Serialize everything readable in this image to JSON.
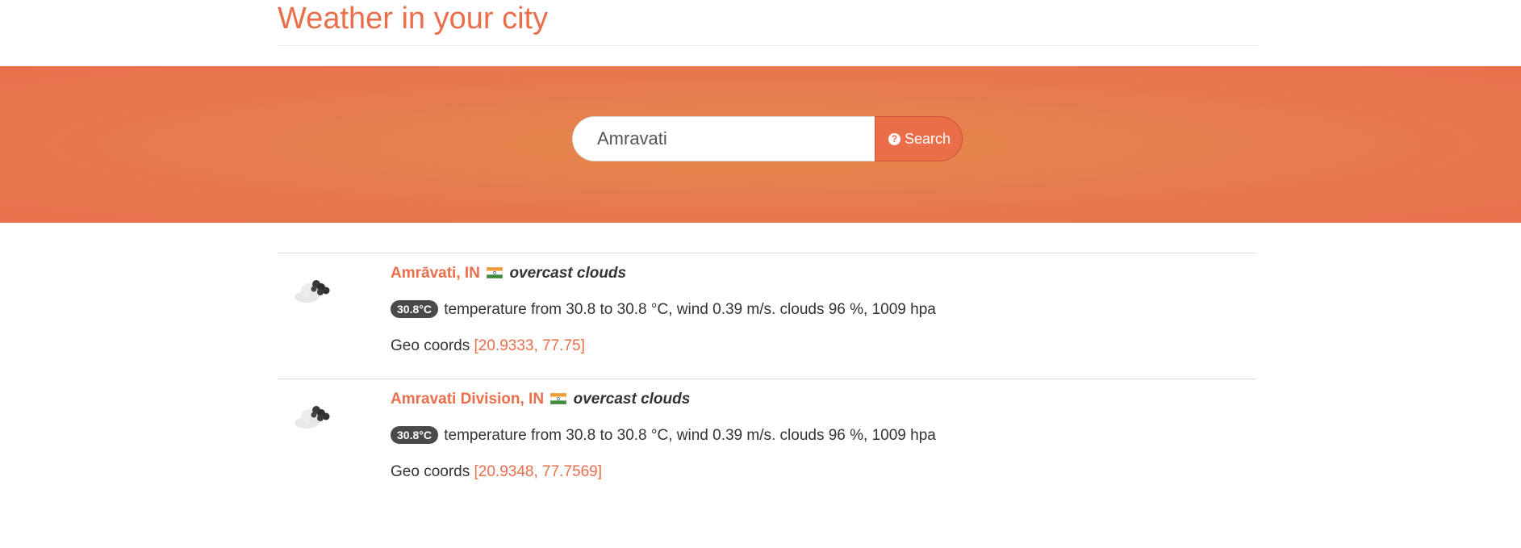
{
  "page": {
    "title": "Weather in your city"
  },
  "search": {
    "value": "Amravati",
    "button_label": "Search",
    "button_icon": "question-circle-icon"
  },
  "colors": {
    "accent": "#eb6e4b",
    "hero_center": "#e4894c",
    "hero_edge": "#e9704d",
    "badge": "#4a4a4a"
  },
  "results": [
    {
      "city": "Amrāvati, IN",
      "flag": "india-flag-icon",
      "description": "overcast clouds",
      "temperature_badge": "30.8°C",
      "details": "temperature from 30.8 to 30.8 °C, wind 0.39 m/s. clouds 96 %, 1009 hpa",
      "geo_label": "Geo coords",
      "coords": "[20.9333, 77.75]",
      "icon": "overcast-clouds-icon"
    },
    {
      "city": "Amravati Division, IN",
      "flag": "india-flag-icon",
      "description": "overcast clouds",
      "temperature_badge": "30.8°C",
      "details": "temperature from 30.8 to 30.8 °C, wind 0.39 m/s. clouds 96 %, 1009 hpa",
      "geo_label": "Geo coords",
      "coords": "[20.9348, 77.7569]",
      "icon": "overcast-clouds-icon"
    }
  ]
}
